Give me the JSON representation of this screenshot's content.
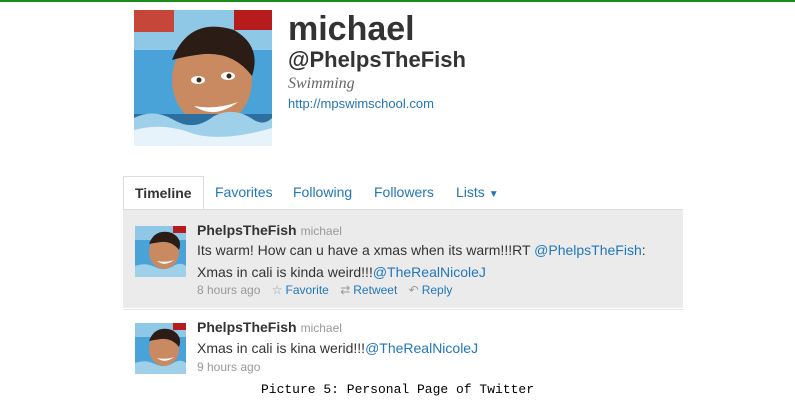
{
  "profile": {
    "name": "michael",
    "handle": "@PhelpsTheFish",
    "bio": "Swimming",
    "url": "http://mpswimschool.com"
  },
  "tabs": [
    {
      "label": "Timeline",
      "active": true
    },
    {
      "label": "Favorites"
    },
    {
      "label": "Following"
    },
    {
      "label": "Followers"
    },
    {
      "label": "Lists"
    }
  ],
  "tweets": [
    {
      "username": "PhelpsTheFish",
      "display_name": "michael",
      "text_1": "Its warm! How can u have a xmas when its warm!!!RT",
      "mention_1": "@PhelpsTheFish",
      "text_2": ": Xmas in cali is kinda weird!!!",
      "mention_2": "@TheRealNicoleJ",
      "time": "8 hours ago",
      "actions": {
        "favorite": "Favorite",
        "retweet": "Retweet",
        "reply": "Reply"
      }
    },
    {
      "username": "PhelpsTheFish",
      "display_name": "michael",
      "text_1": "Xmas in cali is kina werid!!!",
      "mention_1": "@TheRealNicoleJ",
      "time": "9 hours ago"
    }
  ],
  "caption": "Picture 5: Personal Page of Twitter",
  "colors": {
    "link": "#2276bb",
    "highlight_bg": "#ebebeb",
    "top_rule": "#1a8c1a"
  },
  "icons": [
    "star-icon",
    "retweet-icon",
    "reply-icon",
    "caret-down-icon"
  ]
}
